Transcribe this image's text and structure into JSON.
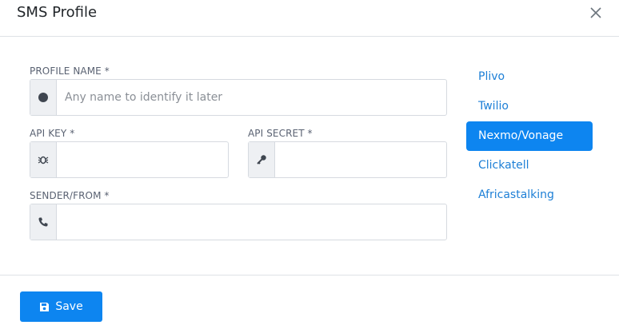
{
  "modal": {
    "title": "SMS Profile"
  },
  "form": {
    "profile_name": {
      "label": "PROFILE NAME *",
      "placeholder": "Any name to identify it later",
      "value": "",
      "icon": "circle-icon"
    },
    "api_key": {
      "label": "API KEY *",
      "placeholder": "",
      "value": "",
      "icon": "bug-icon"
    },
    "api_secret": {
      "label": "API SECRET *",
      "placeholder": "",
      "value": "",
      "icon": "key-icon"
    },
    "sender": {
      "label": "SENDER/FROM *",
      "placeholder": "",
      "value": "",
      "icon": "phone-icon"
    }
  },
  "providers": [
    {
      "label": "Plivo",
      "active": false
    },
    {
      "label": "Twilio",
      "active": false
    },
    {
      "label": "Nexmo/Vonage",
      "active": true
    },
    {
      "label": "Clickatell",
      "active": false
    },
    {
      "label": "Africastalking",
      "active": false
    }
  ],
  "footer": {
    "save_label": "Save",
    "save_icon": "floppy-disk-icon"
  },
  "colors": {
    "accent": "#0d85f0",
    "link": "#1d7fd6",
    "addon_bg": "#eef0f3",
    "border": "#d6dae0"
  }
}
